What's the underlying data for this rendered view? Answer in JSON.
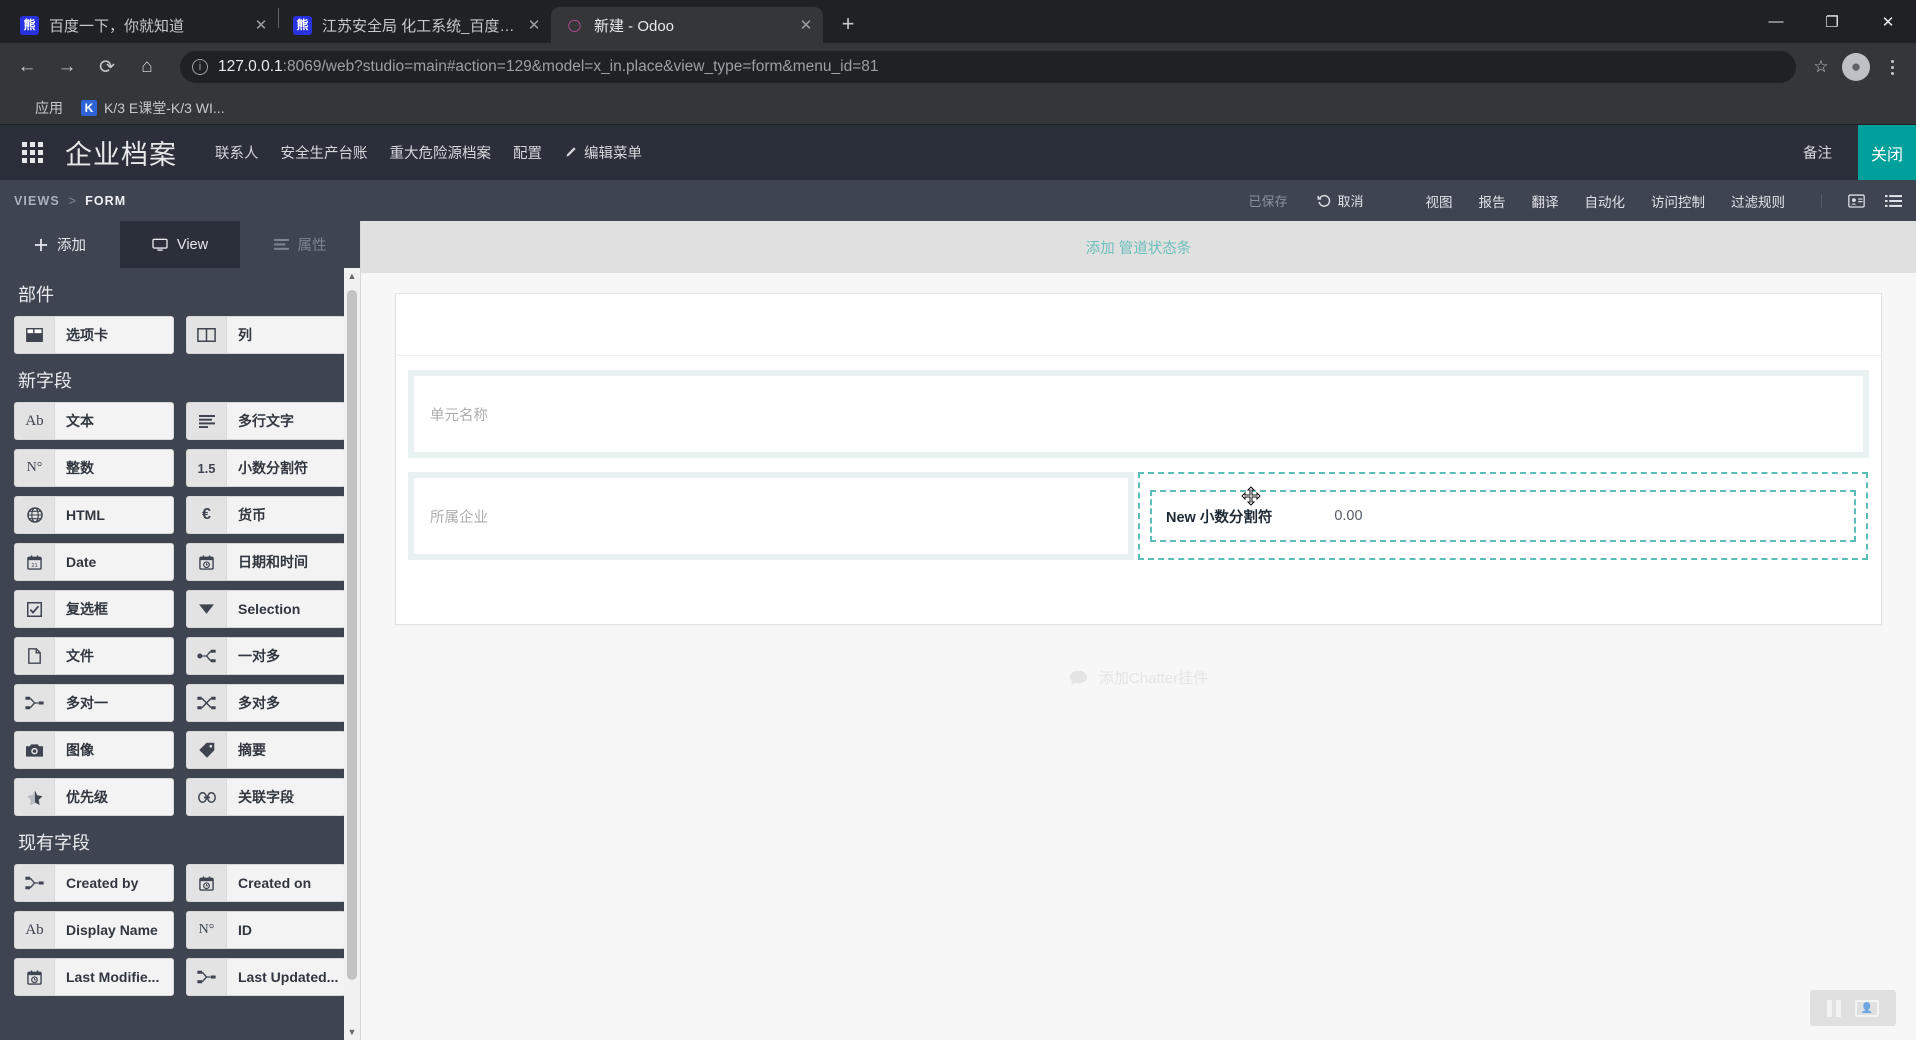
{
  "browser": {
    "tabs": [
      {
        "title": "百度一下，你就知道",
        "favicon": "baidu-icon",
        "active": false
      },
      {
        "title": "江苏安全局 化工系统_百度搜索",
        "favicon": "baidu-icon",
        "active": false
      },
      {
        "title": "新建 - Odoo",
        "favicon": "odoo-icon",
        "active": true
      }
    ],
    "new_tab_label": "+",
    "close_label": "✕",
    "window_controls": {
      "minimize": "—",
      "maximize": "❐",
      "close": "✕"
    },
    "nav": {
      "back": "←",
      "forward": "→",
      "reload": "⟳",
      "home": "⌂"
    },
    "omnibox": {
      "info_icon": "ⓘ",
      "url_host": "127.0.0.1",
      "url_rest": ":8069/web?studio=main#action=129&model=x_in.place&view_type=form&menu_id=81"
    },
    "star_icon": "☆",
    "bookmarks": [
      {
        "label": "应用",
        "icon": "apps-grid-icon"
      },
      {
        "label": "K/3 E课堂-K/3 WI...",
        "icon": "k3-icon",
        "icon_text": "K"
      }
    ]
  },
  "odoo": {
    "apps_icon": "apps-grid-icon",
    "brand": "企业档案",
    "menus": [
      {
        "label": "联系人"
      },
      {
        "label": "安全生产台账"
      },
      {
        "label": "重大危险源档案"
      },
      {
        "label": "配置"
      },
      {
        "label": "编辑菜单",
        "icon": "pencil-icon"
      }
    ],
    "notes_label": "备注",
    "close_label": "关闭",
    "accent_color": "#00a09d"
  },
  "studio_bar": {
    "breadcrumb": {
      "root": "VIEWS",
      "separator": ">",
      "current": "FORM"
    },
    "saved_label": "已保存",
    "undo_label": "取消",
    "undo_icon": "undo-icon",
    "links": [
      {
        "label": "视图"
      },
      {
        "label": "报告"
      },
      {
        "label": "翻译"
      },
      {
        "label": "自动化"
      },
      {
        "label": "访问控制"
      },
      {
        "label": "过滤规则"
      }
    ],
    "icons": [
      {
        "name": "card-view-icon"
      },
      {
        "name": "list-view-icon"
      }
    ]
  },
  "sidebar": {
    "tabs": [
      {
        "label": "添加",
        "icon": "plus-icon",
        "active": true
      },
      {
        "label": "View",
        "icon": "monitor-icon",
        "active": false
      },
      {
        "label": "属性",
        "icon": "properties-icon",
        "active": false,
        "disabled": true
      }
    ],
    "sections": [
      {
        "heading": "部件",
        "items": [
          {
            "label": "选项卡",
            "icon": "tabs-icon"
          },
          {
            "label": "列",
            "icon": "columns-icon"
          }
        ]
      },
      {
        "heading": "新字段",
        "items": [
          {
            "label": "文本",
            "icon": "text-ab-icon"
          },
          {
            "label": "多行文字",
            "icon": "multiline-text-icon"
          },
          {
            "label": "整数",
            "icon": "number-icon"
          },
          {
            "label": "小数分割符",
            "icon": "decimal-icon"
          },
          {
            "label": "HTML",
            "icon": "globe-icon"
          },
          {
            "label": "货币",
            "icon": "euro-icon"
          },
          {
            "label": "Date",
            "icon": "calendar-icon"
          },
          {
            "label": "日期和时间",
            "icon": "calendar-clock-icon"
          },
          {
            "label": "复选框",
            "icon": "checkbox-icon"
          },
          {
            "label": "Selection",
            "icon": "caret-down-icon"
          },
          {
            "label": "文件",
            "icon": "file-icon"
          },
          {
            "label": "一对多",
            "icon": "one2many-icon"
          },
          {
            "label": "多对一",
            "icon": "many2one-icon"
          },
          {
            "label": "多对多",
            "icon": "many2many-icon"
          },
          {
            "label": "图像",
            "icon": "camera-icon"
          },
          {
            "label": "摘要",
            "icon": "tag-icon"
          },
          {
            "label": "优先级",
            "icon": "star-half-icon"
          },
          {
            "label": "关联字段",
            "icon": "link-icon"
          }
        ]
      },
      {
        "heading": "现有字段",
        "items": [
          {
            "label": "Created by",
            "icon": "many2one-icon"
          },
          {
            "label": "Created on",
            "icon": "calendar-clock-icon"
          },
          {
            "label": "Display Name",
            "icon": "text-ab-icon"
          },
          {
            "label": "ID",
            "icon": "number-icon"
          },
          {
            "label": "Last Modifie...",
            "icon": "calendar-clock-icon"
          },
          {
            "label": "Last Updated...",
            "icon": "many2one-icon"
          }
        ]
      }
    ],
    "scroll": {
      "up": "▲",
      "down": "▼"
    }
  },
  "form": {
    "statusbar_placeholder": "添加 管道状态条",
    "rows": [
      {
        "type": "single",
        "fields": [
          {
            "placeholder": "单元名称"
          }
        ]
      },
      {
        "type": "pair",
        "fields": [
          {
            "placeholder": "所属企业"
          },
          {
            "new_field_label": "New 小数分割符",
            "new_field_value": "0.00",
            "cursor": "move-cursor"
          }
        ]
      }
    ],
    "chatter_placeholder": "添加Chatter挂件",
    "chatter_icon": "comment-icon"
  },
  "recorder": {
    "pause_icon": "pause-icon",
    "screen_icon": "screen-icon"
  }
}
